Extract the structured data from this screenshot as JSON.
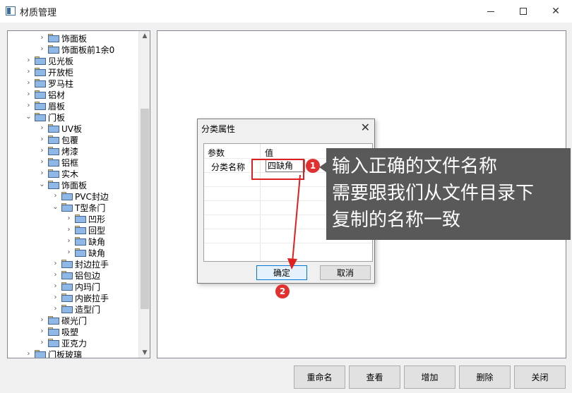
{
  "window": {
    "title": "材质管理"
  },
  "tree": {
    "items": [
      {
        "label": "饰面板",
        "level": 2,
        "expanded": false
      },
      {
        "label": "饰面板前1余0",
        "level": 2,
        "expanded": false
      },
      {
        "label": "见光板",
        "level": 1,
        "expanded": false
      },
      {
        "label": "开放柜",
        "level": 1,
        "expanded": false
      },
      {
        "label": "罗马柱",
        "level": 1,
        "expanded": false
      },
      {
        "label": "铝材",
        "level": 1,
        "expanded": false
      },
      {
        "label": "眉板",
        "level": 1,
        "expanded": false
      },
      {
        "label": "门板",
        "level": 1,
        "expanded": true
      },
      {
        "label": "UV板",
        "level": 2,
        "expanded": false
      },
      {
        "label": "包覆",
        "level": 2,
        "expanded": false
      },
      {
        "label": "烤漆",
        "level": 2,
        "expanded": false
      },
      {
        "label": "铝框",
        "level": 2,
        "expanded": false
      },
      {
        "label": "实木",
        "level": 2,
        "expanded": false
      },
      {
        "label": "饰面板",
        "level": 2,
        "expanded": true
      },
      {
        "label": "PVC封边",
        "level": 3,
        "expanded": false
      },
      {
        "label": "T型条门",
        "level": 3,
        "expanded": true
      },
      {
        "label": "凹形",
        "level": 4,
        "expanded": false
      },
      {
        "label": "回型",
        "level": 4,
        "expanded": false
      },
      {
        "label": "缺角",
        "level": 4,
        "expanded": false
      },
      {
        "label": "缺角",
        "level": 4,
        "expanded": false
      },
      {
        "label": "封边拉手",
        "level": 3,
        "expanded": false
      },
      {
        "label": "铝包边",
        "level": 3,
        "expanded": false
      },
      {
        "label": "内玛门",
        "level": 3,
        "expanded": false
      },
      {
        "label": "内嵌拉手",
        "level": 3,
        "expanded": false
      },
      {
        "label": "造型门",
        "level": 3,
        "expanded": false
      },
      {
        "label": "碳光门",
        "level": 2,
        "expanded": false
      },
      {
        "label": "吸塑",
        "level": 2,
        "expanded": false
      },
      {
        "label": "亚克力",
        "level": 2,
        "expanded": false
      },
      {
        "label": "门板玻璃",
        "level": 1,
        "expanded": false
      }
    ]
  },
  "buttons": {
    "rename": "重命名",
    "view": "查看",
    "add": "增加",
    "delete": "删除",
    "close": "关闭"
  },
  "dialog": {
    "title": "分类属性",
    "col_param": "参数",
    "col_value": "值",
    "row_label": "分类名称",
    "row_value": "四缺角",
    "ok": "确定",
    "cancel": "取消"
  },
  "annotations": {
    "badge1": "1",
    "badge2": "2",
    "callout_lines": [
      "输入正确的文件名称",
      "需要跟我们从文件目录下",
      "复制的名称一致"
    ],
    "accent_color": "#e02020"
  }
}
